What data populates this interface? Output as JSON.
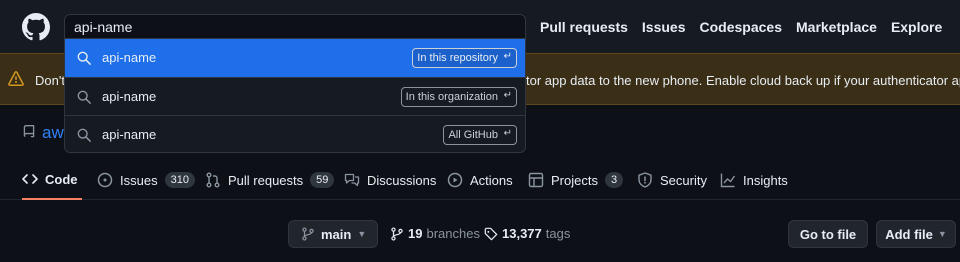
{
  "header": {
    "search_value": "api-name",
    "nav": [
      "Pull requests",
      "Issues",
      "Codespaces",
      "Marketplace",
      "Explore"
    ]
  },
  "banner": {
    "text_left": "Don't",
    "text_right": "tor app data to the new phone. Enable cloud back up if your authenticator app sup"
  },
  "repo": {
    "name_partial": "aw"
  },
  "search_dropdown": {
    "items": [
      {
        "text": "api-name",
        "scope": "In this repository"
      },
      {
        "text": "api-name",
        "scope": "In this organization"
      },
      {
        "text": "api-name",
        "scope": "All GitHub"
      }
    ]
  },
  "tabs": [
    {
      "label": "Code",
      "count": ""
    },
    {
      "label": "Issues",
      "count": "310"
    },
    {
      "label": "Pull requests",
      "count": "59"
    },
    {
      "label": "Discussions",
      "count": ""
    },
    {
      "label": "Actions",
      "count": ""
    },
    {
      "label": "Projects",
      "count": "3"
    },
    {
      "label": "Security",
      "count": ""
    },
    {
      "label": "Insights",
      "count": ""
    }
  ],
  "branch_bar": {
    "branch": "main",
    "branches_count": "19",
    "branches_label": "branches",
    "tags_count": "13,377",
    "tags_label": "tags",
    "go_to_file": "Go to file",
    "add_file": "Add file"
  },
  "colors": {
    "background": "#0d1117",
    "header": "#161b22",
    "accent": "#1f6feb",
    "link": "#2f81f7",
    "warning_banner": "#3b2e16",
    "tab_underline": "#f78166"
  }
}
